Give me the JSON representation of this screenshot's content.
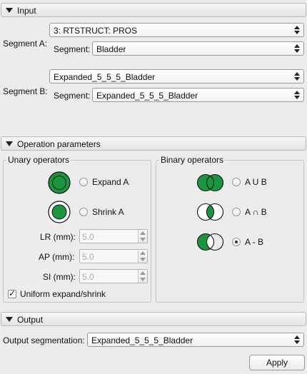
{
  "input": {
    "header": "Input",
    "segment_a": {
      "label": "Segment A:",
      "structure": "3: RTSTRUCT: PROS",
      "segment_label": "Segment:",
      "segment": "Bladder"
    },
    "segment_b": {
      "label": "Segment B:",
      "structure": "Expanded_5_5_5_Bladder",
      "segment_label": "Segment:",
      "segment": "Expanded_5_5_5_Bladder"
    }
  },
  "operation": {
    "header": "Operation parameters",
    "unary": {
      "title": "Unary operators",
      "expand_label": "Expand A",
      "shrink_label": "Shrink A",
      "lr_label": "LR (mm):",
      "ap_label": "AP (mm):",
      "si_label": "SI (mm):",
      "lr_value": "5.0",
      "ap_value": "5.0",
      "si_value": "5.0",
      "uniform_label": "Uniform expand/shrink",
      "uniform_checked": true
    },
    "binary": {
      "title": "Binary operators",
      "union_label": "A U B",
      "intersect_label": "A ∩ B",
      "subtract_label": "A - B",
      "selected": "subtract"
    },
    "colors": {
      "fill": "#1a9641"
    }
  },
  "output": {
    "header": "Output",
    "label": "Output segmentation:",
    "value": "Expanded_5_5_5_Bladder",
    "apply_label": "Apply"
  }
}
